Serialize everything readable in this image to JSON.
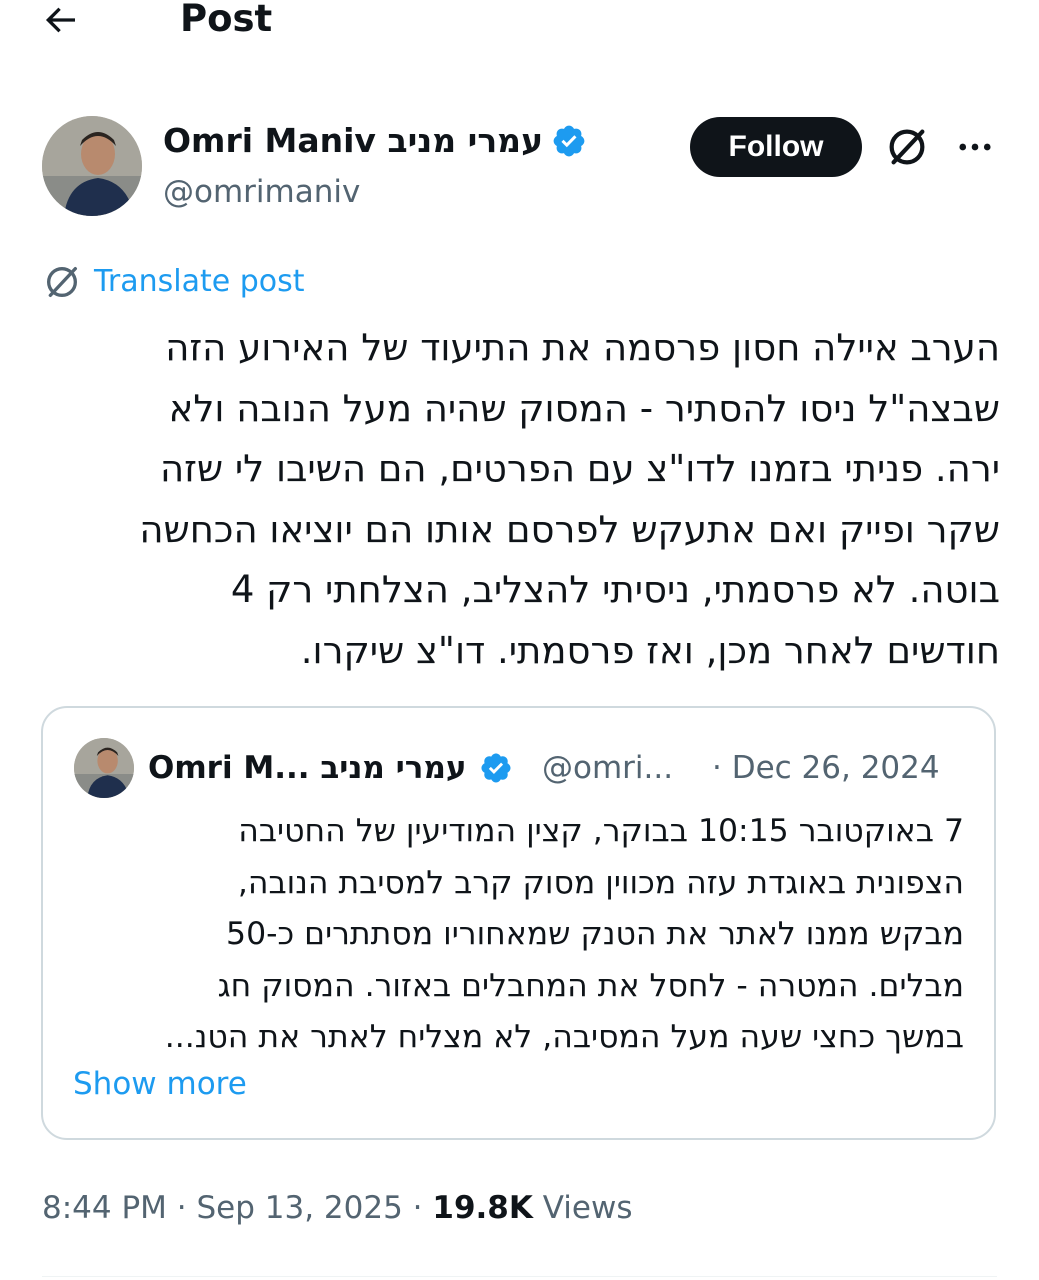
{
  "header": {
    "back_icon": "arrow-left-icon",
    "title": "Post"
  },
  "author": {
    "name": "Omri Maniv עמרי מניב",
    "handle": "@omrimaniv",
    "verified": true,
    "verified_color": "#1d9bf0"
  },
  "actions": {
    "follow_label": "Follow",
    "grok_icon": "grok-icon",
    "more_icon": "more-horizontal-icon"
  },
  "translate": {
    "label": "Translate post",
    "icon": "grok-icon"
  },
  "post": {
    "lines": [
      "הערב איילה חסון פרסמה את התיעוד של האירוע הזה",
      "שבצה\"ל ניסו להסתיר - המסוק שהיה מעל הנובה ולא",
      "ירה. פניתי בזמנו לדו\"צ עם הפרטים, הם השיבו לי שזה",
      "שקר ופייק ואם אתעקש לפרסם אותו הם יוציאו הכחשה",
      "בוטה. לא פרסמתי, ניסיתי להצליב, הצלחתי רק 4",
      "חודשים לאחר מכן, ואז פרסמתי. דו\"צ שיקרו."
    ]
  },
  "quote": {
    "name": "Omri M... עמרי מניב",
    "handle": "@omri...",
    "date": "· Dec 26, 2024",
    "lines": [
      "7 באוקטובר 10:15 בבוקר, קצין המודיעין של החטיבה",
      "הצפונית באוגדת עזה מכווין מסוק קרב למסיבת הנובה,",
      "מבקש ממנו לאתר את הטנק שמאחוריו מסתתרים כ-50",
      "מבלים. המטרה - לחסל את המחבלים באזור. המסוק חג",
      "במשך כחצי שעה מעל המסיבה, לא מצליח לאתר את הטנ..."
    ],
    "show_more": "Show more"
  },
  "meta": {
    "time": "8:44 PM",
    "sep1": " · ",
    "date": "Sep 13, 2025",
    "sep2": " · ",
    "views_count": "19.8K",
    "views_label": " Views"
  },
  "colors": {
    "text": "#0f1419",
    "secondary": "#536471",
    "accent": "#1d9bf0",
    "border": "#cfd9de"
  }
}
